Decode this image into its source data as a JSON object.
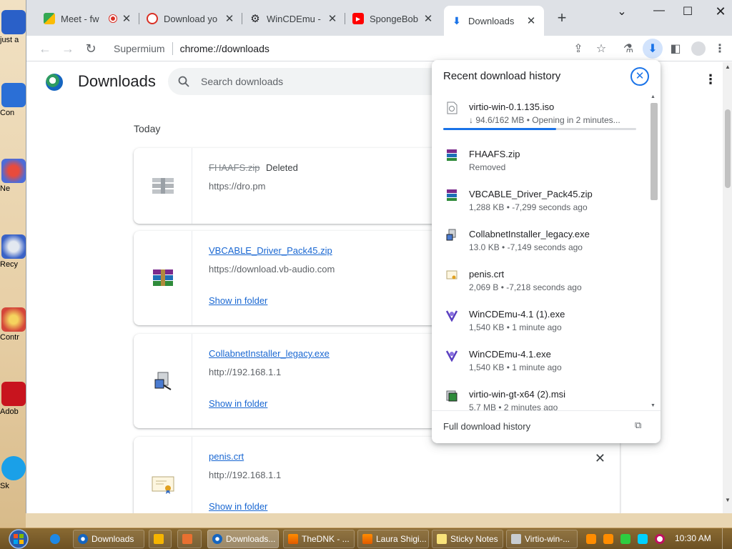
{
  "desktop": {
    "icons": [
      {
        "label": "just a",
        "name": "desktop-icon-just"
      },
      {
        "label": "Con",
        "name": "desktop-icon-computer"
      },
      {
        "label": "Ne",
        "name": "desktop-icon-network"
      },
      {
        "label": "Recy",
        "name": "desktop-icon-recycle-bin"
      },
      {
        "label": "Contr",
        "name": "desktop-icon-control-panel"
      },
      {
        "label": "Adob",
        "name": "desktop-icon-adobe"
      },
      {
        "label": "Sk",
        "name": "desktop-icon-skype"
      }
    ]
  },
  "tabs": [
    {
      "title": "Meet - fw",
      "icon": "meet-icon"
    },
    {
      "title": "Download yo",
      "icon": "opera-icon"
    },
    {
      "title": "WinCDEmu -",
      "icon": "gear-icon"
    },
    {
      "title": "SpongeBob's",
      "icon": "youtube-icon"
    },
    {
      "title": "Downloads",
      "icon": "download-icon"
    }
  ],
  "toolbar": {
    "site": "Supermium",
    "url": "chrome://downloads"
  },
  "page": {
    "title": "Downloads",
    "search_placeholder": "Search downloads",
    "section": "Today",
    "show_in_folder": "Show in folder"
  },
  "downloads": [
    {
      "name": "FHAAFS.zip",
      "status": "Deleted",
      "url": "https://dro.pm",
      "deleted": true,
      "icon": "zip-icon"
    },
    {
      "name": "VBCABLE_Driver_Pack45.zip",
      "status": "",
      "url": "https://download.vb-audio.com",
      "deleted": false,
      "icon": "winrar-icon"
    },
    {
      "name": "CollabnetInstaller_legacy.exe",
      "status": "",
      "url": "http://192.168.1.1",
      "deleted": false,
      "icon": "installer-icon"
    },
    {
      "name": "penis.crt",
      "status": "",
      "url": "http://192.168.1.1",
      "deleted": false,
      "icon": "certificate-icon"
    }
  ],
  "popup": {
    "title": "Recent download history",
    "footer": "Full download history",
    "items": [
      {
        "name": "virtio-win-0.1.135.iso",
        "sub": "↓ 94.6/162 MB • Opening in 2 minutes...",
        "progress": 0.584,
        "icon": "disc-file-icon"
      },
      {
        "name": "FHAAFS.zip",
        "sub": "Removed",
        "icon": "winrar-icon"
      },
      {
        "name": "VBCABLE_Driver_Pack45.zip",
        "sub": "1,288 KB • -7,299 seconds ago",
        "icon": "winrar-icon"
      },
      {
        "name": "CollabnetInstaller_legacy.exe",
        "sub": "13.0 KB • -7,149 seconds ago",
        "icon": "installer-icon"
      },
      {
        "name": "penis.crt",
        "sub": "2,069 B • -7,218 seconds ago",
        "icon": "certificate-icon"
      },
      {
        "name": "WinCDEmu-4.1 (1).exe",
        "sub": "1,540 KB • 1 minute ago",
        "icon": "wincdemu-icon"
      },
      {
        "name": "WinCDEmu-4.1.exe",
        "sub": "1,540 KB • 1 minute ago",
        "icon": "wincdemu-icon"
      },
      {
        "name": "virtio-win-gt-x64 (2).msi",
        "sub": "5.7 MB • 2 minutes ago",
        "icon": "msi-icon"
      }
    ]
  },
  "taskbar": {
    "buttons": [
      {
        "label": "Downloads",
        "icon": "chrome-icon",
        "active": false
      },
      {
        "label": "Downloads...",
        "icon": "chrome-icon",
        "active": true
      },
      {
        "label": "TheDNK - ...",
        "icon": "vlc-icon",
        "active": false
      },
      {
        "label": "Laura Shigi...",
        "icon": "vlc-icon",
        "active": false
      },
      {
        "label": "Sticky Notes",
        "icon": "sticky-notes-icon",
        "active": false
      },
      {
        "label": "Virtio-win-...",
        "icon": "installer-icon",
        "active": false
      }
    ],
    "clock": "10:30 AM"
  },
  "colors": {
    "accent": "#1a73e8",
    "link": "#1967d2"
  }
}
